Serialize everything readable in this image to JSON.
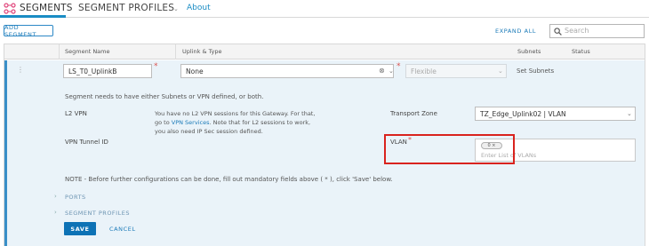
{
  "tabs": {
    "segments": "SEGMENTS",
    "segment_profiles": "SEGMENT PROFILES",
    "about": "About"
  },
  "toolbar": {
    "add_segment": "ADD SEGMENT",
    "expand_all": "EXPAND ALL",
    "search_placeholder": "Search"
  },
  "columns": {
    "segment_name": "Segment Name",
    "uplink_type": "Uplink & Type",
    "subnets": "Subnets",
    "status": "Status"
  },
  "row": {
    "segment_name_value": "LS_T0_UplinkB",
    "uplink_value": "None",
    "type_value": "Flexible",
    "set_subnets": "Set Subnets",
    "requirement_note": "Segment needs to have either Subnets or VPN defined, or both.",
    "l2vpn_label": "L2 VPN",
    "l2vpn_desc_1": "You have no L2 VPN sessions for this Gateway. For that,",
    "l2vpn_desc_2_pre": "go to ",
    "l2vpn_desc_2_link": "VPN Services",
    "l2vpn_desc_2_post": ". Note that for L2 sessions to work,",
    "l2vpn_desc_3": "you also need IP Sec session defined.",
    "transport_zone_label": "Transport Zone",
    "transport_zone_value": "TZ_Edge_Uplink02 | VLAN",
    "vpn_tunnel_label": "VPN Tunnel ID",
    "vlan_label": "VLAN",
    "vlan_chip": "0",
    "vlan_placeholder": "Enter List of VLANs",
    "note_prefix": "NOTE",
    "note_text": " - Before further configurations can be done, fill out mandatory fields above ( * ), click '",
    "note_save": "Save",
    "note_suffix": "' below.",
    "ports": "PORTS",
    "segment_profiles": "SEGMENT PROFILES",
    "save": "SAVE",
    "cancel": "CANCEL"
  },
  "colors": {
    "accent": "#0d72b5",
    "row_bg": "#eaf3f9",
    "highlight": "#d9231e"
  }
}
